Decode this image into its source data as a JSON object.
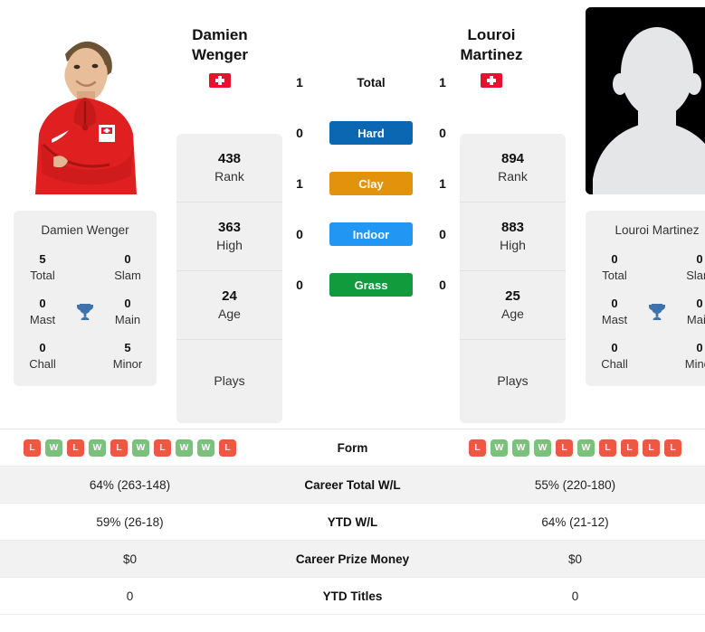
{
  "players": {
    "left": {
      "first_name": "Damien",
      "last_name": "Wenger",
      "full_name": "Damien Wenger",
      "country": "Switzerland",
      "rank": "438",
      "rank_label": "Rank",
      "high": "363",
      "high_label": "High",
      "age": "24",
      "age_label": "Age",
      "plays": "Plays",
      "titles": {
        "total": "5",
        "total_label": "Total",
        "slam": "0",
        "slam_label": "Slam",
        "mast": "0",
        "mast_label": "Mast",
        "main": "0",
        "main_label": "Main",
        "chall": "0",
        "chall_label": "Chall",
        "minor": "5",
        "minor_label": "Minor"
      },
      "surface_wins": {
        "total": "1",
        "hard": "0",
        "clay": "1",
        "indoor": "0",
        "grass": "0"
      },
      "form": [
        "L",
        "W",
        "L",
        "W",
        "L",
        "W",
        "L",
        "W",
        "W",
        "L"
      ],
      "career_wl": "64% (263-148)",
      "ytd_wl": "59% (26-18)",
      "prize_money": "$0",
      "ytd_titles": "0"
    },
    "right": {
      "first_name": "Louroi",
      "last_name": "Martinez",
      "full_name": "Louroi Martinez",
      "country": "Switzerland",
      "rank": "894",
      "rank_label": "Rank",
      "high": "883",
      "high_label": "High",
      "age": "25",
      "age_label": "Age",
      "plays": "Plays",
      "titles": {
        "total": "0",
        "total_label": "Total",
        "slam": "0",
        "slam_label": "Slam",
        "mast": "0",
        "mast_label": "Mast",
        "main": "0",
        "main_label": "Main",
        "chall": "0",
        "chall_label": "Chall",
        "minor": "0",
        "minor_label": "Minor"
      },
      "surface_wins": {
        "total": "1",
        "hard": "0",
        "clay": "1",
        "indoor": "0",
        "grass": "0"
      },
      "form": [
        "L",
        "W",
        "W",
        "W",
        "L",
        "W",
        "L",
        "L",
        "L",
        "L"
      ],
      "career_wl": "55% (220-180)",
      "ytd_wl": "64% (21-12)",
      "prize_money": "$0",
      "ytd_titles": "0"
    }
  },
  "surfaces": [
    {
      "key": "total",
      "label": "Total",
      "color": "transparent"
    },
    {
      "key": "hard",
      "label": "Hard",
      "color": "#0b67b2"
    },
    {
      "key": "clay",
      "label": "Clay",
      "color": "#e2930b"
    },
    {
      "key": "indoor",
      "label": "Indoor",
      "color": "#2196f3"
    },
    {
      "key": "grass",
      "label": "Grass",
      "color": "#119b3c"
    }
  ],
  "table_rows": [
    {
      "label": "Form",
      "left": "",
      "right": ""
    },
    {
      "label": "Career Total W/L",
      "left": "64% (263-148)",
      "right": "55% (220-180)"
    },
    {
      "label": "YTD W/L",
      "left": "59% (26-18)",
      "right": "64% (21-12)"
    },
    {
      "label": "Career Prize Money",
      "left": "$0",
      "right": "$0"
    },
    {
      "label": "YTD Titles",
      "left": "0",
      "right": "0"
    }
  ],
  "colors": {
    "win": "#7bc07b",
    "loss": "#ee5843",
    "panel": "#f0f0f0",
    "flag_red": "#e8112d",
    "trophy": "#3f71ab"
  }
}
